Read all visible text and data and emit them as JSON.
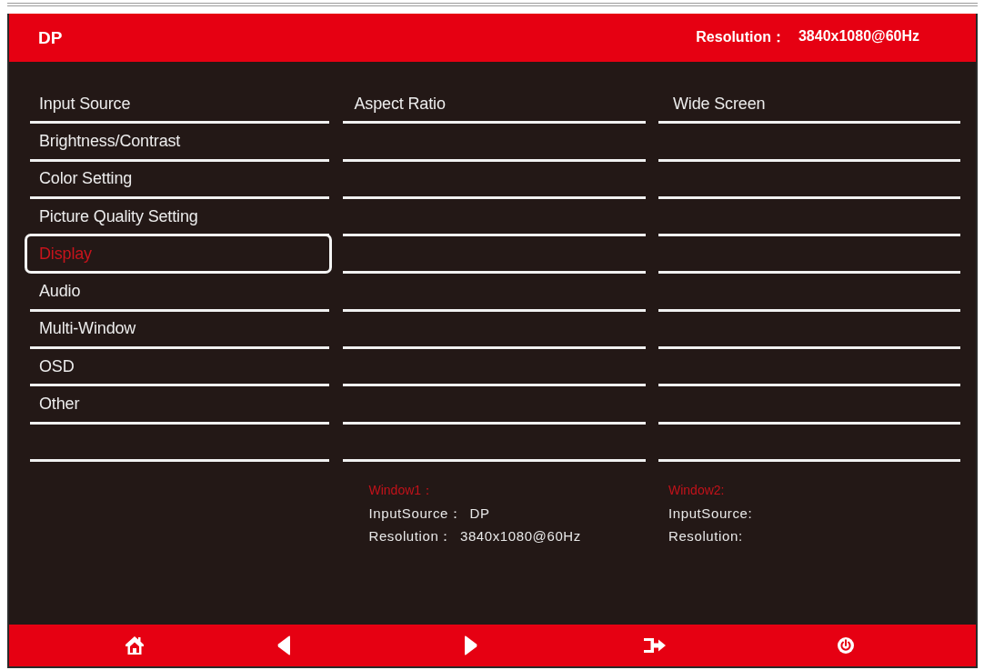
{
  "header": {
    "title": "DP",
    "resolution_label": "Resolution：",
    "resolution": "3840x1080@60Hz"
  },
  "menu": [
    {
      "label": "Input Source",
      "selected": false
    },
    {
      "label": "Brightness/Contrast",
      "selected": false
    },
    {
      "label": "Color Setting",
      "selected": false
    },
    {
      "label": "Picture Quality Setting",
      "selected": false
    },
    {
      "label": "Display",
      "selected": true
    },
    {
      "label": "Audio",
      "selected": false
    },
    {
      "label": "Multi-Window",
      "selected": false
    },
    {
      "label": "OSD",
      "selected": false
    },
    {
      "label": "Other",
      "selected": false
    }
  ],
  "submenu": [
    {
      "label": "Aspect Ratio"
    }
  ],
  "options": [
    {
      "label": "Wide Screen"
    }
  ],
  "windows": [
    {
      "title": "Window1：",
      "input_source_label": "InputSource：",
      "input_source": "DP",
      "resolution_label": "Resolution：",
      "resolution": "3840x1080@60Hz"
    },
    {
      "title": "Window2:",
      "input_source_label": "InputSource:",
      "resolution_label": "Resolution:"
    }
  ]
}
